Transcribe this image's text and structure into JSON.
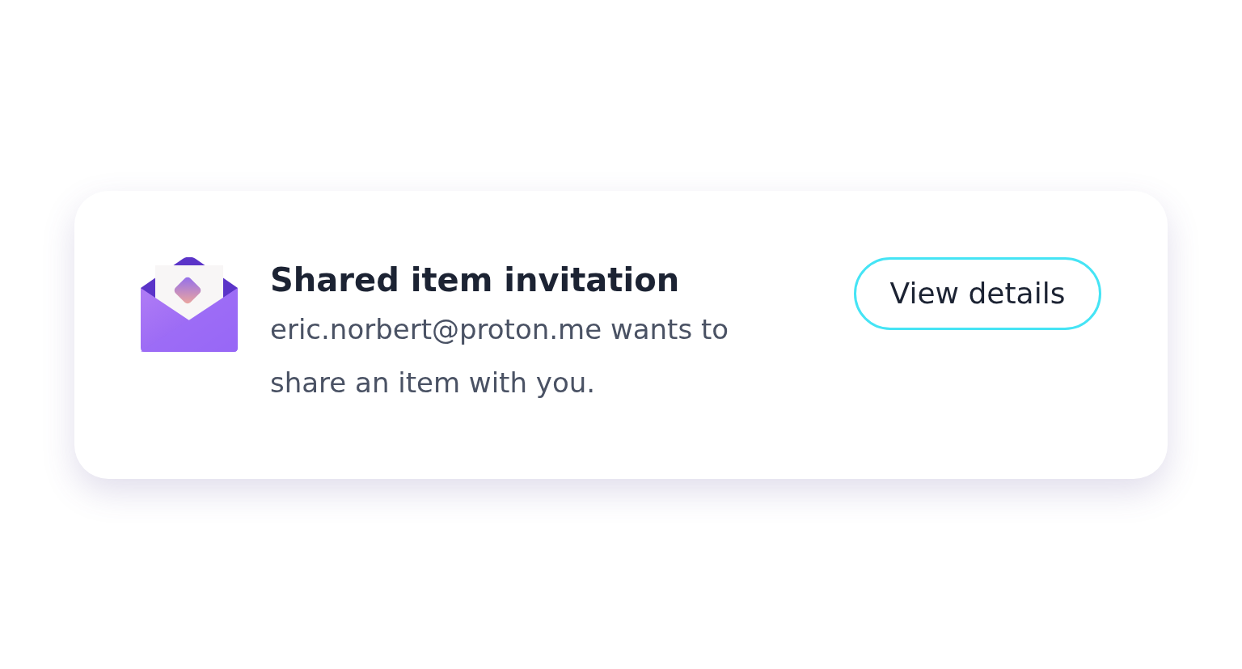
{
  "notification": {
    "title": "Shared item invitation",
    "message": "eric.norbert@proton.me wants to share an item with you.",
    "button": "View details"
  }
}
